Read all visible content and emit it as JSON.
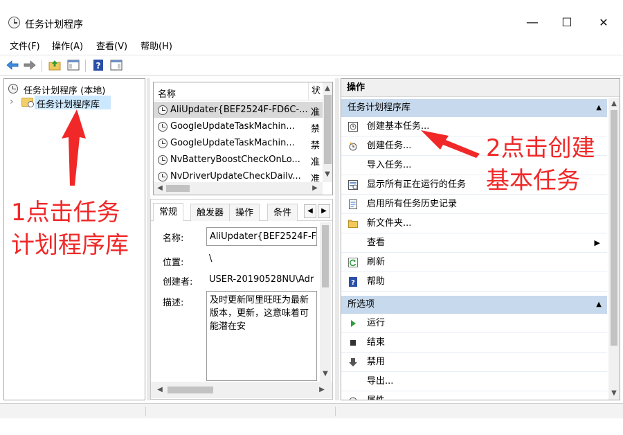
{
  "window": {
    "title": "任务计划程序",
    "minimize": "—",
    "maximize": "☐",
    "close": "✕"
  },
  "menu": {
    "items": [
      "文件(F)",
      "操作(A)",
      "查看(V)",
      "帮助(H)"
    ]
  },
  "tree": {
    "root_label": "任务计划程序 (本地)",
    "child_label": "任务计划程序库",
    "expander": "›"
  },
  "task_list": {
    "col_name": "名称",
    "col_status": "状",
    "rows": [
      {
        "name": "AliUpdater{BEF2524F-FD6C-...",
        "status": "准"
      },
      {
        "name": "GoogleUpdateTaskMachin...",
        "status": "禁"
      },
      {
        "name": "GoogleUpdateTaskMachin...",
        "status": "禁"
      },
      {
        "name": "NvBatteryBoostCheckOnLo...",
        "status": "准"
      },
      {
        "name": "NvDriverUpdateCheckDailv...",
        "status": "准"
      }
    ]
  },
  "details": {
    "tabs": [
      "常规",
      "触发器",
      "操作",
      "条件"
    ],
    "name_label": "名称:",
    "name_value": "AliUpdater{BEF2524F-FD",
    "location_label": "位置:",
    "location_value": "\\",
    "author_label": "创建者:",
    "author_value": "USER-20190528NU\\Adr",
    "desc_label": "描述:",
    "desc_value": "及时更新阿里旺旺为最新版本，更新，这意味着可能潜在安"
  },
  "actions": {
    "header": "操作",
    "section1": "任务计划程序库",
    "items1": [
      {
        "label": "创建基本任务...",
        "icon": "create-basic-task-icon"
      },
      {
        "label": "创建任务...",
        "icon": "create-task-icon"
      },
      {
        "label": "导入任务...",
        "icon": ""
      },
      {
        "label": "显示所有正在运行的任务",
        "icon": "running-tasks-icon"
      },
      {
        "label": "启用所有任务历史记录",
        "icon": "history-icon"
      },
      {
        "label": "新文件夹...",
        "icon": "new-folder-icon"
      },
      {
        "label": "查看",
        "icon": ""
      },
      {
        "label": "刷新",
        "icon": "refresh-icon"
      },
      {
        "label": "帮助",
        "icon": "help-icon"
      }
    ],
    "section2": "所选项",
    "items2": [
      {
        "label": "运行",
        "icon": "run-icon"
      },
      {
        "label": "结束",
        "icon": "end-icon"
      },
      {
        "label": "禁用",
        "icon": "disable-icon"
      },
      {
        "label": "导出...",
        "icon": ""
      },
      {
        "label": "属性",
        "icon": "properties-icon"
      }
    ]
  },
  "annotations": {
    "step1_line1": "1点击任务",
    "step1_line2": "计划程序库",
    "step2_line1": "2点击创建",
    "step2_line2": "基本任务",
    "color": "#f02828"
  },
  "colors": {
    "section_bg": "#c7d9ec",
    "selection": "#cce8ff"
  }
}
